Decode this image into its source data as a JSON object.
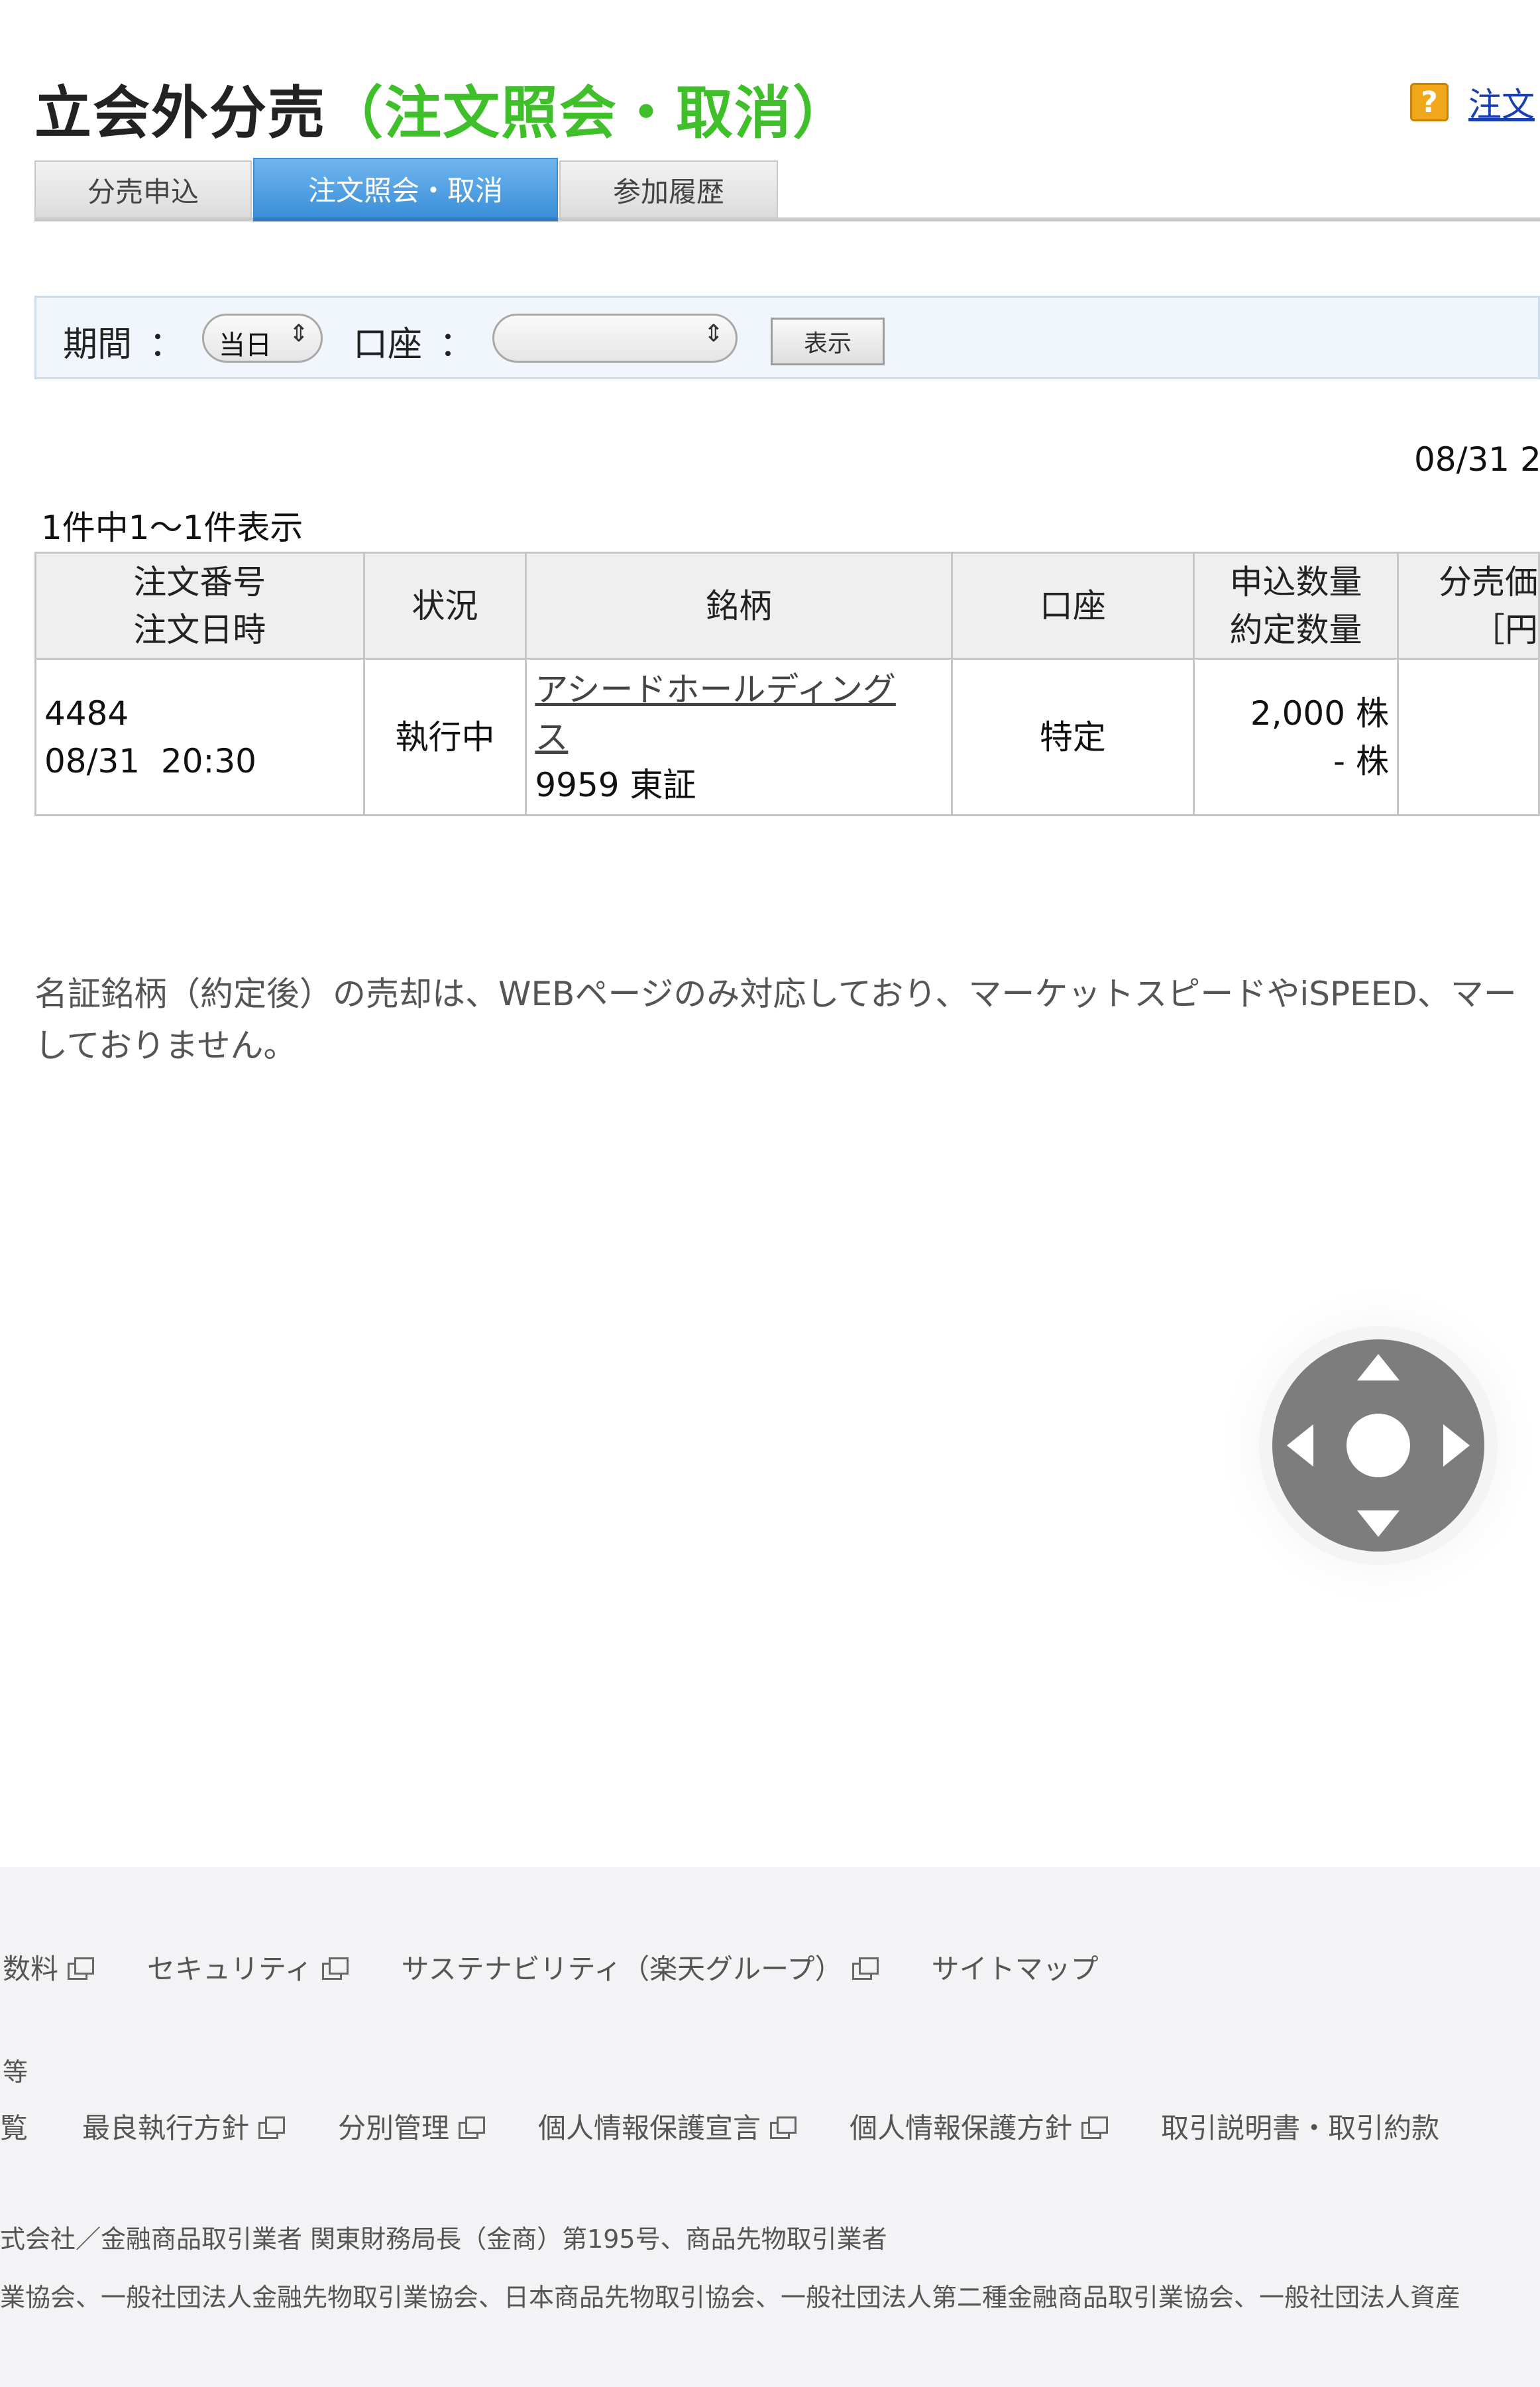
{
  "header": {
    "title_main": "立会外分売",
    "title_sub": "（注文照会・取消）",
    "help_icon": "?",
    "help_link": "注文"
  },
  "tabs": [
    {
      "label": "分売申込",
      "active": false
    },
    {
      "label": "注文照会・取消",
      "active": true
    },
    {
      "label": "参加履歴",
      "active": false
    }
  ],
  "filter": {
    "period_label": "期間",
    "period_value": "当日",
    "account_label": "口座",
    "account_value": "",
    "colon": "：",
    "show_button": "表示"
  },
  "date_display": "08/31 2",
  "result_count": "1件中1～1件表示",
  "table": {
    "headers": {
      "order_no": "注文番号",
      "order_datetime": "注文日時",
      "status": "状況",
      "stock": "銘柄",
      "account": "口座",
      "apply_qty": "申込数量",
      "filled_qty": "約定数量",
      "price_1": "分売価",
      "price_2": "［円"
    },
    "rows": [
      {
        "order_no": "4484",
        "order_datetime": "08/31  20:30",
        "status": "執行中",
        "stock_name_1": "アシードホールディング",
        "stock_name_2": "ス",
        "stock_code": "9959 東証",
        "account": "特定",
        "apply_qty": "2,000 株",
        "filled_qty": "- 株"
      }
    ]
  },
  "note": {
    "line1": "名証銘柄（約定後）の売却は、WEBページのみ対応しており、マーケットスピードやiSPEED、マー",
    "line2": "しておりません。"
  },
  "footer": {
    "row1": [
      "数料",
      "セキュリティ",
      "サステナビリティ（楽天グループ）",
      "サイトマップ"
    ],
    "row2_label": "等",
    "row3": [
      "覧",
      "最良執行方針",
      "分別管理",
      "個人情報保護宣言",
      "個人情報保護方針",
      "取引説明書・取引約款"
    ],
    "company": "式会社／金融商品取引業者 関東財務局長（金商）第195号、商品先物取引業者",
    "associations": "業協会、一般社団法人金融先物取引業協会、日本商品先物取引協会、一般社団法人第二種金融商品取引業協会、一般社団法人資産"
  },
  "colors": {
    "title_accent": "#3fbf2a",
    "tab_active": "#3b8fd9",
    "link": "#1a3fb0"
  }
}
